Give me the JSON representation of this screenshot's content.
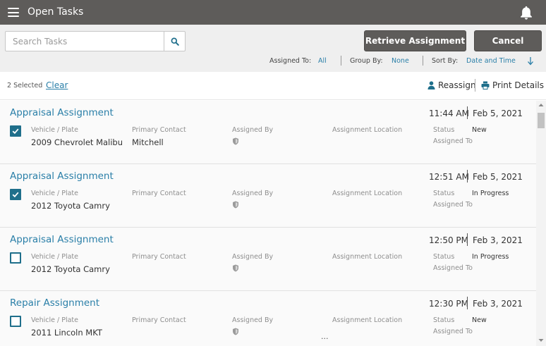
{
  "header": {
    "title": "Open Tasks"
  },
  "toolbar": {
    "search_placeholder": "Search Tasks",
    "retrieve_label": "Retrieve Assignment",
    "cancel_label": "Cancel"
  },
  "filters": {
    "assigned_to_label": "Assigned To:",
    "assigned_to_value": "All",
    "group_by_label": "Group By:",
    "group_by_value": "None",
    "sort_by_label": "Sort By:",
    "sort_by_value": "Date and Time"
  },
  "selection": {
    "count_text": "2 Selected",
    "clear_label": "Clear",
    "reassign_label": "Reassign",
    "print_label": "Print Details"
  },
  "fields": {
    "vehicle": "Vehicle / Plate",
    "contact": "Primary Contact",
    "assigned_by": "Assigned By",
    "location": "Assignment Location",
    "status": "Status",
    "assigned_to": "Assigned To"
  },
  "tasks": [
    {
      "title": "Appraisal Assignment",
      "time": "11:44 AM",
      "date": "Feb 5, 2021",
      "checked": true,
      "vehicle": "2009 Chevrolet Malibu",
      "contact": "Mitchell",
      "status": "New",
      "location": ""
    },
    {
      "title": "Appraisal Assignment",
      "time": "12:51 AM",
      "date": "Feb 5, 2021",
      "checked": true,
      "vehicle": "2012 Toyota Camry",
      "contact": "",
      "status": "In Progress",
      "location": ""
    },
    {
      "title": "Appraisal Assignment",
      "time": "12:50 PM",
      "date": "Feb 3, 2021",
      "checked": false,
      "vehicle": "2012 Toyota Camry",
      "contact": "",
      "status": "In Progress",
      "location": ""
    },
    {
      "title": "Repair Assignment",
      "time": "12:30 PM",
      "date": "Feb 3, 2021",
      "checked": false,
      "vehicle": "2011 Lincoln MKT",
      "contact": "",
      "status": "New",
      "location": "..."
    }
  ],
  "colors": {
    "accent": "#2a7fa8",
    "checkbox": "#1f6f8b",
    "header": "#5e5c5a"
  },
  "icons": [
    "menu-icon",
    "bell-icon",
    "search-icon",
    "person-icon",
    "printer-icon",
    "shield-icon",
    "sort-arrow-down-icon",
    "check-icon"
  ]
}
